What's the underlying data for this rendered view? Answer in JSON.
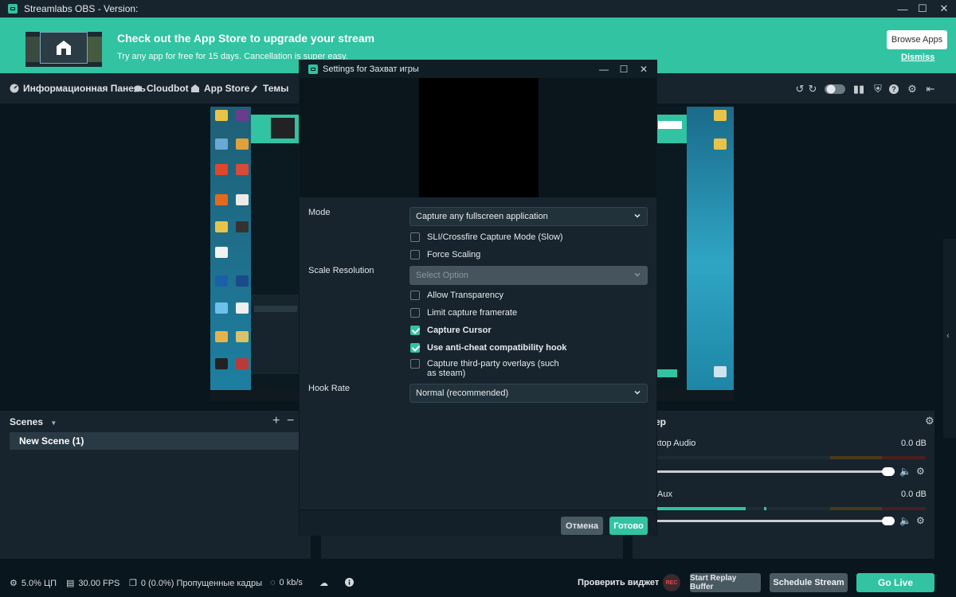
{
  "window": {
    "title": "Streamlabs OBS - Version:"
  },
  "banner": {
    "headline": "Check out the App Store to upgrade your stream",
    "subtext": "Try any app for free for 15 days. Cancellation is super easy.",
    "browse_label": "Browse Apps",
    "dismiss_label": "Dismiss"
  },
  "nav": {
    "items": [
      {
        "label": "Информационная Панель",
        "icon": "dashboard-icon"
      },
      {
        "label": "Cloudbot",
        "icon": "cloudbot-icon"
      },
      {
        "label": "App Store",
        "icon": "store-icon"
      },
      {
        "label": "Темы",
        "icon": "themes-icon"
      }
    ]
  },
  "scenes": {
    "title": "Scenes",
    "items": [
      "New Scene (1)"
    ]
  },
  "mixer": {
    "title": "ер",
    "sources": [
      {
        "name": "ktop Audio",
        "db": "0.0 dB"
      },
      {
        "name": "/Aux",
        "db": "0.0 dB"
      }
    ]
  },
  "status": {
    "cpu": "5.0% ЦП",
    "fps": "30.00 FPS",
    "dropped": "0 (0.0%) Пропущенные кадры",
    "bandwidth": "0 kb/s",
    "test_widgets": "Проверить виджет",
    "rec": "REC",
    "replay": "Start Replay Buffer",
    "schedule": "Schedule Stream",
    "golive": "Go Live"
  },
  "dialog": {
    "title": "Settings for Захват игры",
    "mode_label": "Mode",
    "mode_value": "Capture any fullscreen application",
    "scale_label": "Scale Resolution",
    "scale_placeholder": "Select Option",
    "hook_label": "Hook Rate",
    "hook_value": "Normal (recommended)",
    "checkboxes": [
      {
        "label": "SLI/Crossfire Capture Mode (Slow)",
        "checked": false
      },
      {
        "label": "Force Scaling",
        "checked": false
      },
      {
        "label": "Allow Transparency",
        "checked": false
      },
      {
        "label": "Limit capture framerate",
        "checked": false
      },
      {
        "label": "Capture Cursor",
        "checked": true
      },
      {
        "label": "Use anti-cheat compatibility hook",
        "checked": true
      },
      {
        "label": "Capture third-party overlays (such as steam)",
        "checked": false
      }
    ],
    "cancel_label": "Отмена",
    "done_label": "Готово"
  },
  "colors": {
    "accent": "#31c3a2",
    "background": "#09161d",
    "panel": "#17242d"
  }
}
